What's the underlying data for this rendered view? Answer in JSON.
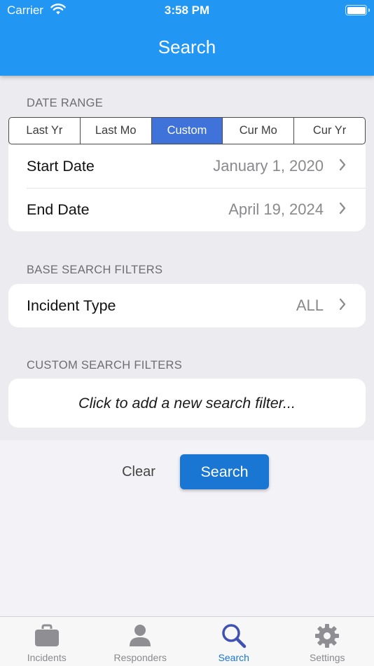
{
  "status_bar": {
    "carrier": "Carrier",
    "time": "3:58 PM"
  },
  "nav": {
    "title": "Search"
  },
  "date_range": {
    "label": "DATE RANGE",
    "segments": [
      "Last Yr",
      "Last Mo",
      "Custom",
      "Cur Mo",
      "Cur Yr"
    ],
    "selected": "Custom",
    "start": {
      "label": "Start Date",
      "value": "January 1, 2020"
    },
    "end": {
      "label": "End Date",
      "value": "April 19, 2024"
    }
  },
  "base_filters": {
    "label": "BASE SEARCH FILTERS",
    "incident_type": {
      "label": "Incident Type",
      "value": "ALL"
    }
  },
  "custom_filters": {
    "label": "CUSTOM SEARCH FILTERS",
    "hint": "Click to add a new search filter..."
  },
  "actions": {
    "clear": "Clear",
    "search": "Search"
  },
  "tabs": [
    {
      "label": "Incidents",
      "icon": "briefcase-icon"
    },
    {
      "label": "Responders",
      "icon": "person-icon"
    },
    {
      "label": "Search",
      "icon": "magnifier-icon"
    },
    {
      "label": "Settings",
      "icon": "gear-icon"
    }
  ],
  "active_tab": "Search",
  "colors": {
    "header": "#2196f3",
    "selected_segment": "#3f73d9",
    "primary_button": "#1976d2",
    "active_tab": "#1976d2"
  }
}
